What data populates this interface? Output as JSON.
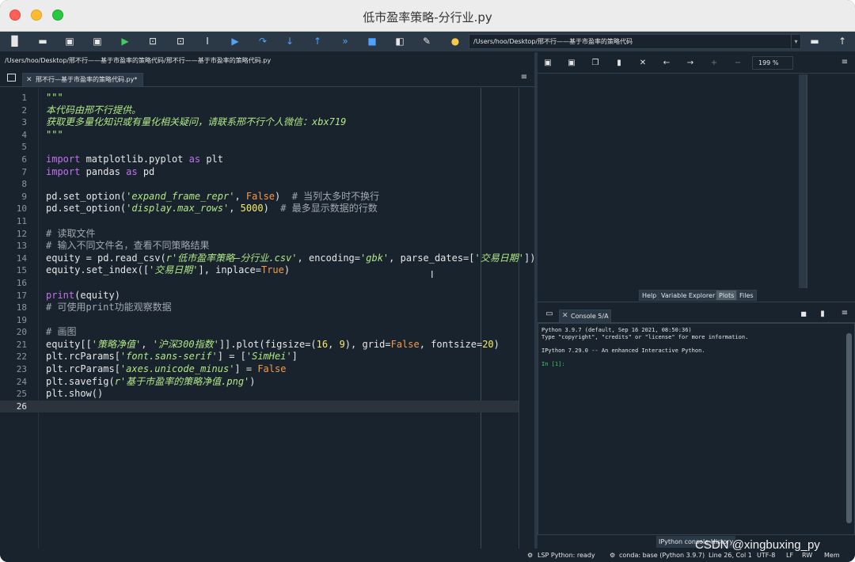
{
  "window": {
    "title": "低市盈率策略-分行业.py"
  },
  "toolbar": {
    "path_value": "/Users/hoo/Desktop/邢不行——基于市盈率的策略代码"
  },
  "editor": {
    "file_path": "/Users/hoo/Desktop/邢不行——基于市盈率的策略代码/邢不行——基于市盈率的策略代码.py",
    "tab_label": "邢不行—基于市盈率的策略代码.py*",
    "line_numbers": [
      "1",
      "2",
      "3",
      "4",
      "5",
      "6",
      "7",
      "8",
      "9",
      "10",
      "11",
      "12",
      "13",
      "14",
      "15",
      "16",
      "17",
      "18",
      "19",
      "20",
      "21",
      "22",
      "23",
      "24",
      "25",
      "26"
    ],
    "code": {
      "l1": "\"\"\"",
      "l2": "本代码由邢不行提供。",
      "l3": "获取更多量化知识或有量化相关疑问，请联系邢不行个人微信：xbx719",
      "l4": "\"\"\"",
      "l6_kw1": "import",
      "l6_mid": " matplotlib.pyplot ",
      "l6_kw2": "as",
      "l6_end": " plt",
      "l7_kw1": "import",
      "l7_mid": " pandas ",
      "l7_kw2": "as",
      "l7_end": " pd",
      "l9_a": "pd.set_option(",
      "l9_s": "'expand_frame_repr'",
      "l9_b": ", ",
      "l9_c": "False",
      "l9_d": ")  ",
      "l9_cm": "# 当列太多时不换行",
      "l10_a": "pd.set_option(",
      "l10_s": "'display.max_rows'",
      "l10_b": ", ",
      "l10_n": "5000",
      "l10_d": ")  ",
      "l10_cm": "# 最多显示数据的行数",
      "l12": "# 读取文件",
      "l13": "# 输入不同文件名，查看不同策略结果",
      "l14_a": "equity = pd.read_csv(",
      "l14_s1": "r'低市盈率策略—分行业.csv'",
      "l14_b": ", encoding=",
      "l14_s2": "'gbk'",
      "l14_c": ", parse_dates=[",
      "l14_s3": "'交易日期'",
      "l14_d": "])",
      "l15_a": "equity.set_index([",
      "l15_s": "'交易日期'",
      "l15_b": "], inplace=",
      "l15_c": "True",
      "l15_d": ")",
      "l17_a": "print",
      "l17_b": "(equity)",
      "l18": "# 可使用print功能观察数据",
      "l20": "# 画图",
      "l21_a": "equity[[",
      "l21_s1": "'策略净值'",
      "l21_b": ", ",
      "l21_s2": "'沪深300指数'",
      "l21_c": "]].plot(figsize=(",
      "l21_n1": "16",
      "l21_d": ", ",
      "l21_n2": "9",
      "l21_e": "), grid=",
      "l21_f": "False",
      "l21_g": ", fontsize=",
      "l21_n3": "20",
      "l21_h": ")",
      "l22_a": "plt.rcParams[",
      "l22_s1": "'font.sans-serif'",
      "l22_b": "] = [",
      "l22_s2": "'SimHei'",
      "l22_c": "]",
      "l23_a": "plt.rcParams[",
      "l23_s": "'axes.unicode_minus'",
      "l23_b": "] = ",
      "l23_c": "False",
      "l24_a": "plt.savefig(",
      "l24_s": "r'基于市盈率的策略净值.png'",
      "l24_b": ")",
      "l25": "plt.show()"
    }
  },
  "plots": {
    "zoom": "199 %",
    "tabs": [
      "Help",
      "Variable Explorer",
      "Plots",
      "Files"
    ]
  },
  "console": {
    "tab_label": "Console 5/A",
    "lines": [
      "Python 3.9.7 (default, Sep 16 2021, 08:50:36)",
      "Type \"copyright\", \"credits\" or \"license\" for more information.",
      "",
      "IPython 7.29.0 -- An enhanced Interactive Python.",
      "",
      "In [1]:"
    ],
    "bottom_tab": "IPython console  History"
  },
  "status": {
    "lsp": "LSP Python: ready",
    "conda": "conda: base (Python 3.9.7)",
    "position": "Line 26, Col 1",
    "encoding": "UTF-8",
    "eol": "LF",
    "rw": "RW",
    "mem": "Mem 71%"
  },
  "watermark": "CSDN @xingbuxing_py",
  "colors": {
    "background": "#19232d",
    "keyword": "#c471ed",
    "string": "#b0e686",
    "number": "#faed5c",
    "constant": "#f59a4b"
  }
}
